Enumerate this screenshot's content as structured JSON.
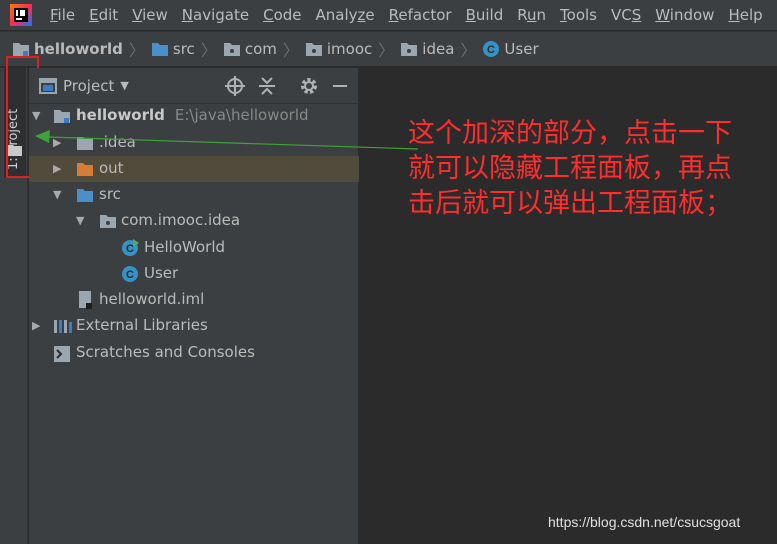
{
  "menu": {
    "items": [
      {
        "pre": "",
        "u": "F",
        "post": "ile"
      },
      {
        "pre": "",
        "u": "E",
        "post": "dit"
      },
      {
        "pre": "",
        "u": "V",
        "post": "iew"
      },
      {
        "pre": "",
        "u": "N",
        "post": "avigate"
      },
      {
        "pre": "",
        "u": "C",
        "post": "ode"
      },
      {
        "pre": "Analy",
        "u": "z",
        "post": "e"
      },
      {
        "pre": "",
        "u": "R",
        "post": "efactor"
      },
      {
        "pre": "",
        "u": "B",
        "post": "uild"
      },
      {
        "pre": "R",
        "u": "u",
        "post": "n"
      },
      {
        "pre": "",
        "u": "T",
        "post": "ools"
      },
      {
        "pre": "VC",
        "u": "S",
        "post": ""
      },
      {
        "pre": "",
        "u": "W",
        "post": "indow"
      },
      {
        "pre": "",
        "u": "H",
        "post": "elp"
      }
    ]
  },
  "breadcrumb": [
    "helloworld",
    "src",
    "com",
    "imooc",
    "idea",
    "User"
  ],
  "stripe": {
    "tab_label": "1: Project"
  },
  "panel": {
    "title": "Project"
  },
  "tree": [
    {
      "label": "helloworld",
      "path": "E:\\java\\helloworld",
      "icon": "module-folder-icon"
    },
    {
      "label": ".idea",
      "icon": "folder-icon"
    },
    {
      "label": "out",
      "icon": "excluded-folder-icon"
    },
    {
      "label": "src",
      "icon": "source-folder-icon"
    },
    {
      "label": "com.imooc.idea",
      "icon": "package-icon"
    },
    {
      "label": "HelloWorld",
      "icon": "runnable-class-icon"
    },
    {
      "label": "User",
      "icon": "class-icon"
    },
    {
      "label": "helloworld.iml",
      "icon": "iml-file-icon"
    },
    {
      "label": "External Libraries",
      "icon": "library-icon"
    },
    {
      "label": "Scratches and Consoles",
      "icon": "scratches-icon"
    }
  ],
  "annotation": {
    "line1": "这个加深的部分，点击一下",
    "line2": "就可以隐藏工程面板，再点",
    "line3": "击后就可以弹出工程面板；"
  },
  "watermark": "https://blog.csdn.net/csucsgoat",
  "colors": {
    "annotation": "#ff2d2d",
    "highlight_box": "#e0201e",
    "arrow": "#3fa33b",
    "selected_row": "#514b3c"
  }
}
